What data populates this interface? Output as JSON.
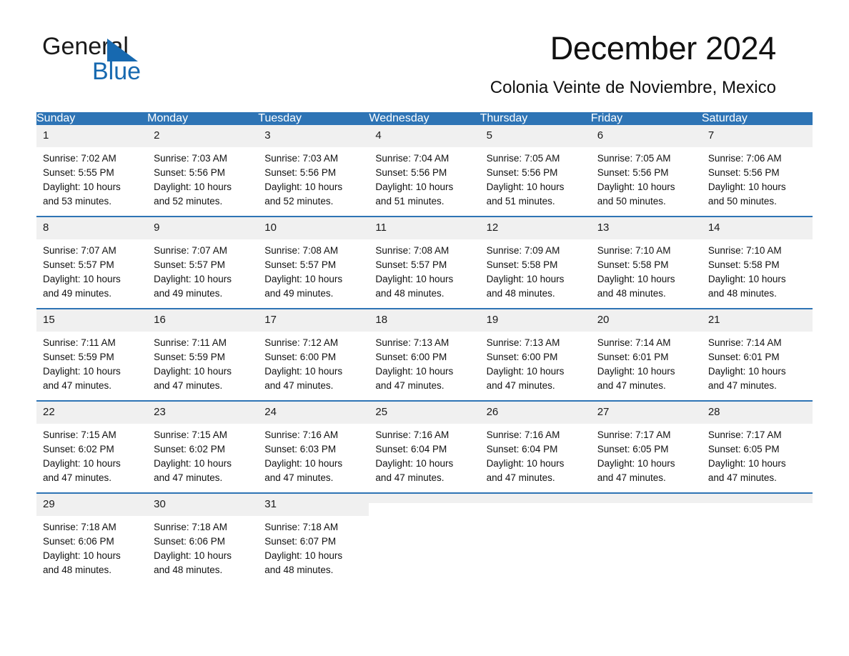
{
  "brand": {
    "name_part1": "General",
    "name_part2": "Blue",
    "triangle_color": "#1769b0"
  },
  "header": {
    "title": "December 2024",
    "subtitle": "Colonia Veinte de Noviembre, Mexico"
  },
  "theme": {
    "header_blue": "#2e74b5",
    "daynum_gray": "#f0f0f0",
    "text": "#111111"
  },
  "calendar": {
    "weekday_headers": [
      "Sunday",
      "Monday",
      "Tuesday",
      "Wednesday",
      "Thursday",
      "Friday",
      "Saturday"
    ],
    "weeks": [
      [
        {
          "day": "1",
          "sunrise": "Sunrise: 7:02 AM",
          "sunset": "Sunset: 5:55 PM",
          "daylight_line1": "Daylight: 10 hours",
          "daylight_line2": "and 53 minutes."
        },
        {
          "day": "2",
          "sunrise": "Sunrise: 7:03 AM",
          "sunset": "Sunset: 5:56 PM",
          "daylight_line1": "Daylight: 10 hours",
          "daylight_line2": "and 52 minutes."
        },
        {
          "day": "3",
          "sunrise": "Sunrise: 7:03 AM",
          "sunset": "Sunset: 5:56 PM",
          "daylight_line1": "Daylight: 10 hours",
          "daylight_line2": "and 52 minutes."
        },
        {
          "day": "4",
          "sunrise": "Sunrise: 7:04 AM",
          "sunset": "Sunset: 5:56 PM",
          "daylight_line1": "Daylight: 10 hours",
          "daylight_line2": "and 51 minutes."
        },
        {
          "day": "5",
          "sunrise": "Sunrise: 7:05 AM",
          "sunset": "Sunset: 5:56 PM",
          "daylight_line1": "Daylight: 10 hours",
          "daylight_line2": "and 51 minutes."
        },
        {
          "day": "6",
          "sunrise": "Sunrise: 7:05 AM",
          "sunset": "Sunset: 5:56 PM",
          "daylight_line1": "Daylight: 10 hours",
          "daylight_line2": "and 50 minutes."
        },
        {
          "day": "7",
          "sunrise": "Sunrise: 7:06 AM",
          "sunset": "Sunset: 5:56 PM",
          "daylight_line1": "Daylight: 10 hours",
          "daylight_line2": "and 50 minutes."
        }
      ],
      [
        {
          "day": "8",
          "sunrise": "Sunrise: 7:07 AM",
          "sunset": "Sunset: 5:57 PM",
          "daylight_line1": "Daylight: 10 hours",
          "daylight_line2": "and 49 minutes."
        },
        {
          "day": "9",
          "sunrise": "Sunrise: 7:07 AM",
          "sunset": "Sunset: 5:57 PM",
          "daylight_line1": "Daylight: 10 hours",
          "daylight_line2": "and 49 minutes."
        },
        {
          "day": "10",
          "sunrise": "Sunrise: 7:08 AM",
          "sunset": "Sunset: 5:57 PM",
          "daylight_line1": "Daylight: 10 hours",
          "daylight_line2": "and 49 minutes."
        },
        {
          "day": "11",
          "sunrise": "Sunrise: 7:08 AM",
          "sunset": "Sunset: 5:57 PM",
          "daylight_line1": "Daylight: 10 hours",
          "daylight_line2": "and 48 minutes."
        },
        {
          "day": "12",
          "sunrise": "Sunrise: 7:09 AM",
          "sunset": "Sunset: 5:58 PM",
          "daylight_line1": "Daylight: 10 hours",
          "daylight_line2": "and 48 minutes."
        },
        {
          "day": "13",
          "sunrise": "Sunrise: 7:10 AM",
          "sunset": "Sunset: 5:58 PM",
          "daylight_line1": "Daylight: 10 hours",
          "daylight_line2": "and 48 minutes."
        },
        {
          "day": "14",
          "sunrise": "Sunrise: 7:10 AM",
          "sunset": "Sunset: 5:58 PM",
          "daylight_line1": "Daylight: 10 hours",
          "daylight_line2": "and 48 minutes."
        }
      ],
      [
        {
          "day": "15",
          "sunrise": "Sunrise: 7:11 AM",
          "sunset": "Sunset: 5:59 PM",
          "daylight_line1": "Daylight: 10 hours",
          "daylight_line2": "and 47 minutes."
        },
        {
          "day": "16",
          "sunrise": "Sunrise: 7:11 AM",
          "sunset": "Sunset: 5:59 PM",
          "daylight_line1": "Daylight: 10 hours",
          "daylight_line2": "and 47 minutes."
        },
        {
          "day": "17",
          "sunrise": "Sunrise: 7:12 AM",
          "sunset": "Sunset: 6:00 PM",
          "daylight_line1": "Daylight: 10 hours",
          "daylight_line2": "and 47 minutes."
        },
        {
          "day": "18",
          "sunrise": "Sunrise: 7:13 AM",
          "sunset": "Sunset: 6:00 PM",
          "daylight_line1": "Daylight: 10 hours",
          "daylight_line2": "and 47 minutes."
        },
        {
          "day": "19",
          "sunrise": "Sunrise: 7:13 AM",
          "sunset": "Sunset: 6:00 PM",
          "daylight_line1": "Daylight: 10 hours",
          "daylight_line2": "and 47 minutes."
        },
        {
          "day": "20",
          "sunrise": "Sunrise: 7:14 AM",
          "sunset": "Sunset: 6:01 PM",
          "daylight_line1": "Daylight: 10 hours",
          "daylight_line2": "and 47 minutes."
        },
        {
          "day": "21",
          "sunrise": "Sunrise: 7:14 AM",
          "sunset": "Sunset: 6:01 PM",
          "daylight_line1": "Daylight: 10 hours",
          "daylight_line2": "and 47 minutes."
        }
      ],
      [
        {
          "day": "22",
          "sunrise": "Sunrise: 7:15 AM",
          "sunset": "Sunset: 6:02 PM",
          "daylight_line1": "Daylight: 10 hours",
          "daylight_line2": "and 47 minutes."
        },
        {
          "day": "23",
          "sunrise": "Sunrise: 7:15 AM",
          "sunset": "Sunset: 6:02 PM",
          "daylight_line1": "Daylight: 10 hours",
          "daylight_line2": "and 47 minutes."
        },
        {
          "day": "24",
          "sunrise": "Sunrise: 7:16 AM",
          "sunset": "Sunset: 6:03 PM",
          "daylight_line1": "Daylight: 10 hours",
          "daylight_line2": "and 47 minutes."
        },
        {
          "day": "25",
          "sunrise": "Sunrise: 7:16 AM",
          "sunset": "Sunset: 6:04 PM",
          "daylight_line1": "Daylight: 10 hours",
          "daylight_line2": "and 47 minutes."
        },
        {
          "day": "26",
          "sunrise": "Sunrise: 7:16 AM",
          "sunset": "Sunset: 6:04 PM",
          "daylight_line1": "Daylight: 10 hours",
          "daylight_line2": "and 47 minutes."
        },
        {
          "day": "27",
          "sunrise": "Sunrise: 7:17 AM",
          "sunset": "Sunset: 6:05 PM",
          "daylight_line1": "Daylight: 10 hours",
          "daylight_line2": "and 47 minutes."
        },
        {
          "day": "28",
          "sunrise": "Sunrise: 7:17 AM",
          "sunset": "Sunset: 6:05 PM",
          "daylight_line1": "Daylight: 10 hours",
          "daylight_line2": "and 47 minutes."
        }
      ],
      [
        {
          "day": "29",
          "sunrise": "Sunrise: 7:18 AM",
          "sunset": "Sunset: 6:06 PM",
          "daylight_line1": "Daylight: 10 hours",
          "daylight_line2": "and 48 minutes."
        },
        {
          "day": "30",
          "sunrise": "Sunrise: 7:18 AM",
          "sunset": "Sunset: 6:06 PM",
          "daylight_line1": "Daylight: 10 hours",
          "daylight_line2": "and 48 minutes."
        },
        {
          "day": "31",
          "sunrise": "Sunrise: 7:18 AM",
          "sunset": "Sunset: 6:07 PM",
          "daylight_line1": "Daylight: 10 hours",
          "daylight_line2": "and 48 minutes."
        },
        {
          "day": "",
          "sunrise": "",
          "sunset": "",
          "daylight_line1": "",
          "daylight_line2": ""
        },
        {
          "day": "",
          "sunrise": "",
          "sunset": "",
          "daylight_line1": "",
          "daylight_line2": ""
        },
        {
          "day": "",
          "sunrise": "",
          "sunset": "",
          "daylight_line1": "",
          "daylight_line2": ""
        },
        {
          "day": "",
          "sunrise": "",
          "sunset": "",
          "daylight_line1": "",
          "daylight_line2": ""
        }
      ]
    ]
  }
}
